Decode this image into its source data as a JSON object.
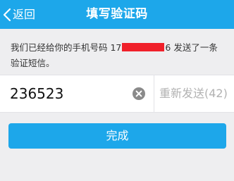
{
  "navbar": {
    "back_label": "返回",
    "title": "填写验证码"
  },
  "info": {
    "text_before": "我们已经给你的手机号码 17",
    "text_after": "6 发送了一条验证短信。"
  },
  "code_input": {
    "value": "236523"
  },
  "resend": {
    "label": "重新发送(42)"
  },
  "done_button": {
    "label": "完成"
  },
  "colors": {
    "accent": "#1da7ea",
    "background": "#eeeef0",
    "redaction": "#f0202a",
    "muted_text": "#b2b2b2"
  },
  "icons": {
    "back": "chevron-left-icon",
    "clear": "clear-circle-x-icon"
  }
}
